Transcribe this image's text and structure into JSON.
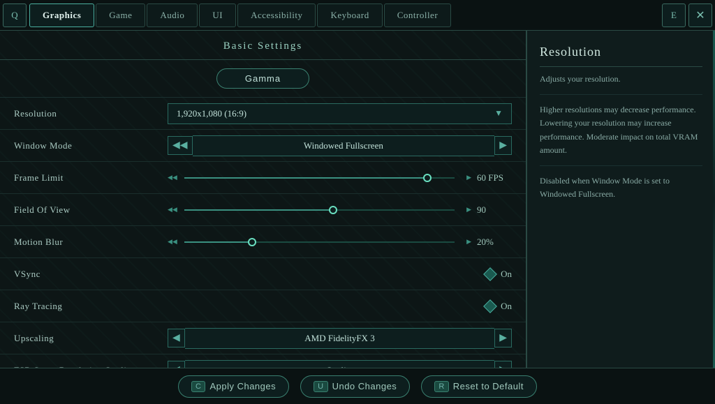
{
  "nav": {
    "left_icon": "Q",
    "right_icon": "E",
    "close_icon": "✕",
    "tabs": [
      {
        "label": "Graphics",
        "active": true
      },
      {
        "label": "Game",
        "active": false
      },
      {
        "label": "Audio",
        "active": false
      },
      {
        "label": "UI",
        "active": false
      },
      {
        "label": "Accessibility",
        "active": false
      },
      {
        "label": "Keyboard",
        "active": false
      },
      {
        "label": "Controller",
        "active": false
      }
    ]
  },
  "left_panel": {
    "section_title": "Basic Settings",
    "gamma_btn": "Gamma",
    "settings": [
      {
        "label": "Resolution",
        "type": "dropdown",
        "value": "1,920x1,080 (16:9)"
      },
      {
        "label": "Window Mode",
        "type": "arrow",
        "value": "Windowed Fullscreen"
      },
      {
        "label": "Frame Limit",
        "type": "slider",
        "fill_pct": 90,
        "thumb_pct": 90,
        "value": "60 FPS"
      },
      {
        "label": "Field Of View",
        "type": "slider",
        "fill_pct": 55,
        "thumb_pct": 55,
        "value": "90"
      },
      {
        "label": "Motion Blur",
        "type": "slider",
        "fill_pct": 25,
        "thumb_pct": 25,
        "value": "20%"
      },
      {
        "label": "VSync",
        "type": "toggle",
        "value": "On"
      },
      {
        "label": "Ray Tracing",
        "type": "toggle",
        "value": "On"
      },
      {
        "label": "Upscaling",
        "type": "arrow",
        "value": "AMD FidelityFX 3"
      },
      {
        "label": "FSR Super Resolution Quality",
        "type": "arrow",
        "value": "Quality"
      }
    ]
  },
  "right_panel": {
    "title": "Resolution",
    "desc1": "Adjusts your resolution.",
    "desc2": "Higher resolutions may decrease performance. Lowering your resolution may increase performance. Moderate impact on total VRAM amount.",
    "desc3": "Disabled when Window Mode is set to Windowed Fullscreen."
  },
  "bottom_bar": {
    "apply_key": "C",
    "apply_label": "Apply Changes",
    "undo_key": "U",
    "undo_label": "Undo Changes",
    "reset_key": "R",
    "reset_label": "Reset to Default"
  }
}
